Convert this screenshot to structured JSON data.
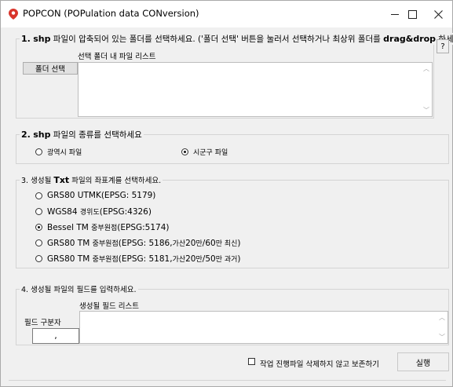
{
  "window": {
    "title": "POPCON (POPulation data CONversion)",
    "icon": "map-pin-icon",
    "controls": {
      "minimize": "–",
      "maximize": "□",
      "close": "✕"
    }
  },
  "section1": {
    "number": "1.",
    "keyword": "shp",
    "legend_rest": "파일이 압축되어 있는 폴더를 선택하세요. ('폴더 선택' 버튼을 눌러서 선택하거나 최상위 폴더를 ",
    "legend_bold_dnd": "drag&drop",
    "legend_tail": " 하세요)",
    "list_label": "선택 폴더 내 파일 리스트",
    "folder_button": "폴더 선택",
    "help_button": "?",
    "files": []
  },
  "section2": {
    "number": "2.",
    "keyword": "shp",
    "legend_rest": "파일의 종류를 선택하세요",
    "options": [
      {
        "label": "광역시 파일",
        "selected": false
      },
      {
        "label": "시군구 파일",
        "selected": true
      }
    ]
  },
  "section3": {
    "prefix": "3. 생성될 ",
    "keyword": "Txt",
    "legend_rest": " 파일의 좌표계를 선택하세요.",
    "options": [
      {
        "main": "GRS80 UTMK(EPSG: 5179)",
        "selected": false
      },
      {
        "main": "WGS84 ",
        "small": "경위도",
        "tail": "(EPSG:4326)",
        "selected": false
      },
      {
        "main": "Bessel TM ",
        "small": "중부원점",
        "tail": "(EPSG:5174)",
        "selected": true
      },
      {
        "main": "GRS80 TM ",
        "small": "중부원점",
        "tail": "(EPSG: 5186, ",
        "small2": "가산 ",
        "tail2": "20",
        "small3": "만",
        "tail3": "/60",
        "small4": "만 최신",
        "tail4": ")",
        "selected": false
      },
      {
        "main": "GRS80 TM ",
        "small": "중부원점",
        "tail": "(EPSG: 5181, ",
        "small2": "가산 ",
        "tail2": "20",
        "small3": "만",
        "tail3": "/50",
        "small4": "만 과거",
        "tail4": ")",
        "selected": false
      }
    ]
  },
  "section4": {
    "legend": "4. 생성될 파일의 필드를 입력하세요.",
    "list_label": "생성될 필드 리스트",
    "separator_label": "필드 구분자",
    "separator_value": ",",
    "fields": []
  },
  "footer": {
    "keep_label": "작업 진행파일 삭제하지 않고 보존하기",
    "keep_checked": false,
    "run_button": "실행"
  }
}
